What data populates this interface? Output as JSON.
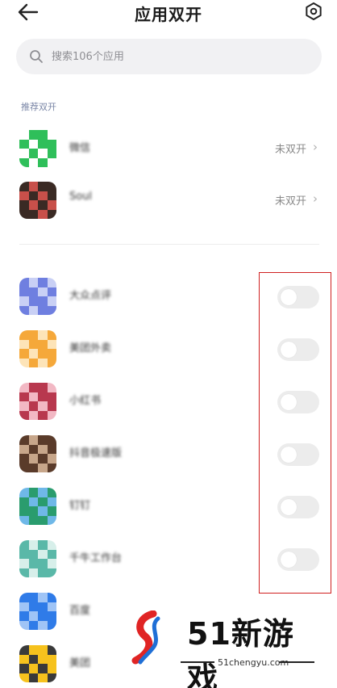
{
  "header": {
    "title": "应用双开"
  },
  "search": {
    "placeholder": "搜索106个应用"
  },
  "recommended": {
    "section_label": "推荐双开",
    "items": [
      {
        "name": "微信",
        "status": "未双开",
        "colors": [
          "#2fbf5a",
          "#ffffff"
        ]
      },
      {
        "name": "Soul",
        "status": "未双开",
        "colors": [
          "#3a2a24",
          "#c8504a"
        ]
      }
    ]
  },
  "apps": [
    {
      "name": "大众点评",
      "toggle_on": false,
      "colors": [
        "#6f7fe0",
        "#c9d0f5"
      ]
    },
    {
      "name": "美团外卖",
      "toggle_on": false,
      "colors": [
        "#f5a83a",
        "#fde4b8"
      ]
    },
    {
      "name": "小红书",
      "toggle_on": false,
      "colors": [
        "#b8384e",
        "#f2b8c4"
      ]
    },
    {
      "name": "抖音极速版",
      "toggle_on": false,
      "colors": [
        "#5a3b2a",
        "#c7a68a"
      ]
    },
    {
      "name": "钉钉",
      "toggle_on": false,
      "colors": [
        "#2a9c6e",
        "#6fb8e8"
      ]
    },
    {
      "name": "千牛工作台",
      "toggle_on": false,
      "colors": [
        "#5ab8a8",
        "#d7efea"
      ]
    },
    {
      "name": "百度",
      "toggle_on": false,
      "colors": [
        "#2f7be8",
        "#9fc4f6"
      ]
    },
    {
      "name": "美团",
      "toggle_on": false,
      "colors": [
        "#f6c21d",
        "#3a3a3a"
      ]
    }
  ],
  "watermark": {
    "brand": "51新游戏",
    "url": "51chengyu.com"
  }
}
